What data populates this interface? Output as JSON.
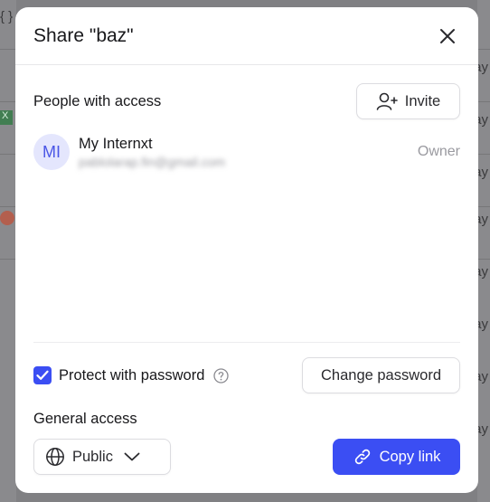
{
  "background": {
    "left_fragments": [
      "{ }",
      "X"
    ],
    "right_fragment": "ay"
  },
  "modal": {
    "title": "Share \"baz\"",
    "people_section_label": "People with access",
    "invite_label": "Invite",
    "people": [
      {
        "initials": "MI",
        "name": "My Internxt",
        "email": "pablolarap.fin@gmail.com",
        "role": "Owner"
      }
    ],
    "protect_label": "Protect with password",
    "protect_checked": true,
    "change_password_label": "Change password",
    "general_access_label": "General access",
    "access_value": "Public",
    "copy_link_label": "Copy link"
  },
  "colors": {
    "accent": "#3b4ef3",
    "avatar_bg": "#e4e6fd",
    "avatar_text": "#4a56e6",
    "muted_text": "#9a9aa0"
  },
  "icons": {
    "close": "close-icon",
    "invite": "user-plus-icon",
    "help": "question-circle-icon",
    "check": "check-icon",
    "globe": "globe-icon",
    "chevron": "chevron-down-icon",
    "link": "link-icon"
  }
}
